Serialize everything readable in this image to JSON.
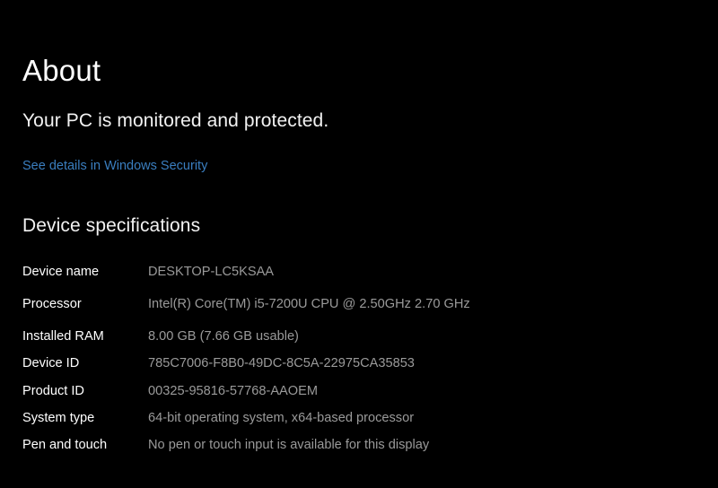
{
  "page": {
    "title": "About",
    "protection_status": "Your PC is monitored and protected.",
    "security_link": "See details in Windows Security"
  },
  "device_specifications": {
    "heading": "Device specifications",
    "rows": [
      {
        "label": "Device name",
        "value": "DESKTOP-LC5KSAA"
      },
      {
        "label": "Processor",
        "value": "Intel(R) Core(TM) i5-7200U CPU @ 2.50GHz   2.70 GHz"
      },
      {
        "label": "Installed RAM",
        "value": "8.00 GB (7.66 GB usable)"
      },
      {
        "label": "Device ID",
        "value": "785C7006-F8B0-49DC-8C5A-22975CA35853"
      },
      {
        "label": "Product ID",
        "value": "00325-95816-57768-AAOEM"
      },
      {
        "label": "System type",
        "value": "64-bit operating system, x64-based processor"
      },
      {
        "label": "Pen and touch",
        "value": "No pen or touch input is available for this display"
      }
    ]
  },
  "colors": {
    "background": "#000000",
    "label_text": "#ffffff",
    "value_text": "#9a9a9a",
    "link": "#3a7ebf"
  }
}
